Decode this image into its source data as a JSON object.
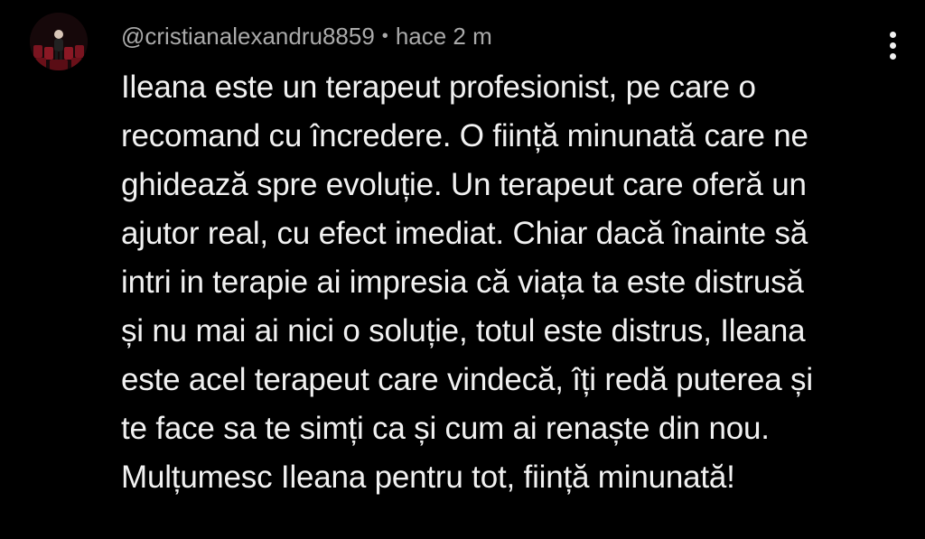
{
  "comment": {
    "author": "@cristianalexandru8859",
    "separator": "•",
    "timestamp": "hace 2 m",
    "avatar_icon": "user-avatar-icon",
    "menu_icon": "more-vertical-icon",
    "text_lines": [
      "Ileana este un terapeut profesionist, pe care o",
      "recomand cu încredere. O ființă minunată care ne",
      "ghidează spre evoluție. Un terapeut care oferă un",
      "ajutor real, cu efect imediat. Chiar dacă înainte să",
      "intri in terapie ai impresia că viața ta este distrusă",
      "și nu mai ai nici o soluție, totul este distrus, Ileana",
      "este acel terapeut care vindecă, îți redă puterea și",
      "te face sa te simți ca și cum ai renaște din nou.",
      "Mulțumesc Ileana pentru tot, ființă minunată!"
    ]
  },
  "colors": {
    "background": "#000000",
    "text": "#f1f1f1",
    "meta": "#aaaaaa"
  }
}
